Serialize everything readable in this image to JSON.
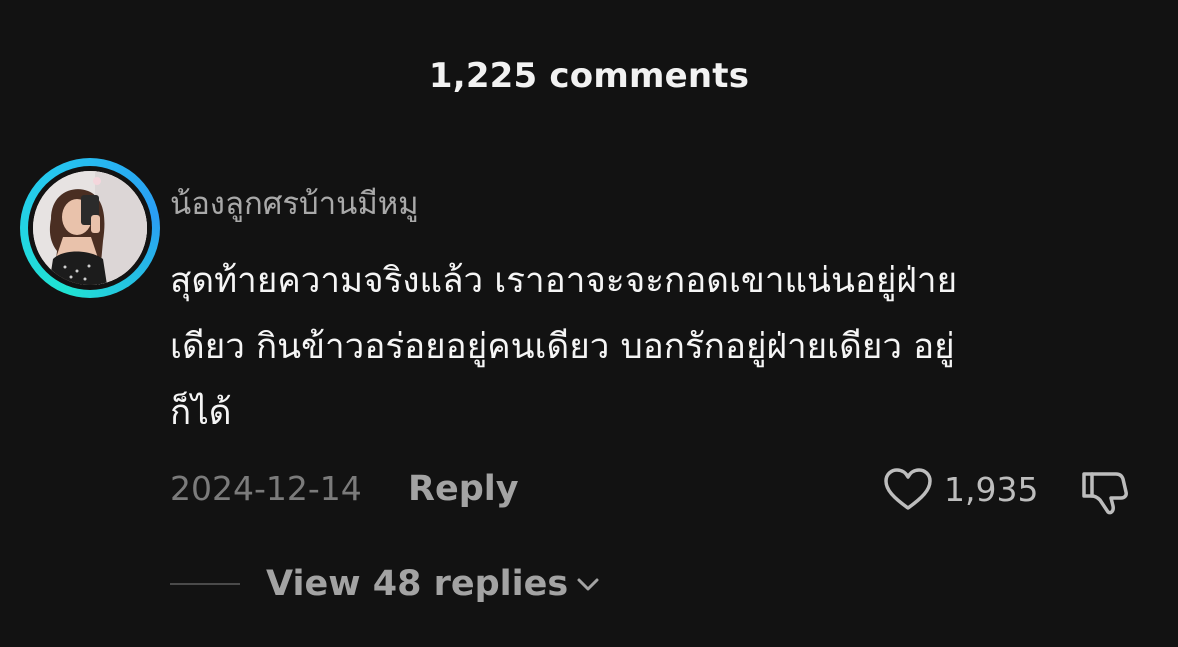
{
  "header": {
    "title": "1,225 comments"
  },
  "comment": {
    "username": "น้องลูกศรบ้านมีหมู",
    "text_lines": [
      "สุดท้ายความจริงแล้ว เราอาจะจะกอดเขาแน่นอยู่ฝ่าย",
      "เดียว กินข้าวอร่อยอยู่คนเดียว บอกรักอยู่ฝ่ายเดียว อยู่",
      "ก็ได้"
    ],
    "date": "2024-12-14",
    "reply_label": "Reply",
    "like_count": "1,935",
    "view_replies_label": "View 48 replies",
    "icons": {
      "like": "heart-icon",
      "dislike": "thumbs-down-icon",
      "expand": "chevron-down-icon"
    }
  },
  "colors": {
    "background": "#121212",
    "avatar_ring": "#25c9ef",
    "muted_text": "#a3a3a3"
  }
}
